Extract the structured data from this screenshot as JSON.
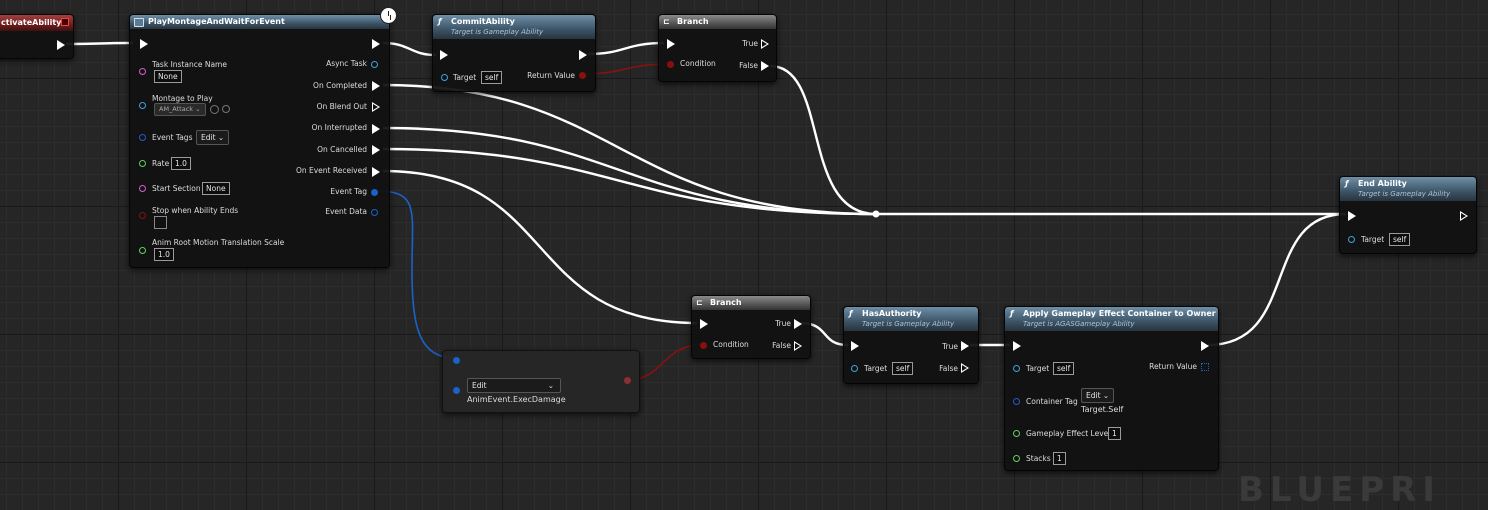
{
  "watermark": "BLUEPRI",
  "nodes": {
    "activate": {
      "title": "ctivateAbility"
    },
    "play_montage": {
      "title": "PlayMontageAndWaitForEvent",
      "task_instance_name": {
        "label": "Task Instance Name",
        "value": "None"
      },
      "montage_to_play": {
        "label": "Montage to Play",
        "value": "AM_Attack"
      },
      "event_tags": {
        "label": "Event Tags",
        "value": "Edit"
      },
      "rate": {
        "label": "Rate",
        "value": "1.0"
      },
      "start_section": {
        "label": "Start Section",
        "value": "None"
      },
      "stop_when_ability_ends": {
        "label": "Stop when Ability Ends"
      },
      "anim_root_motion": {
        "label": "Anim Root Motion Translation Scale",
        "value": "1.0"
      },
      "outputs": [
        "Async Task",
        "On Completed",
        "On Blend Out",
        "On Interrupted",
        "On Cancelled",
        "On Event Received",
        "Event Tag",
        "Event Data"
      ]
    },
    "commit_ability": {
      "title": "CommitAbility",
      "subtitle": "Target is Gameplay Ability",
      "target_label": "Target",
      "target_value": "self",
      "return_label": "Return Value"
    },
    "branch1": {
      "title": "Branch",
      "condition": "Condition",
      "true": "True",
      "false": "False"
    },
    "end_ability": {
      "title": "End Ability",
      "subtitle": "Target is Gameplay Ability",
      "target_label": "Target",
      "target_value": "self"
    },
    "make_tag": {
      "dropdown": "Edit",
      "tag_value": "AnimEvent.ExecDamage"
    },
    "branch2": {
      "title": "Branch",
      "condition": "Condition",
      "true": "True",
      "false": "False"
    },
    "has_authority": {
      "title": "HasAuthority",
      "subtitle": "Target is Gameplay Ability",
      "target_label": "Target",
      "target_value": "self",
      "true": "True",
      "false": "False"
    },
    "apply_ge": {
      "title": "Apply Gameplay Effect Container to Owner",
      "subtitle": "Target is AGASGameplay Ability",
      "target_label": "Target",
      "target_value": "self",
      "return_label": "Return Value",
      "container_tag_label": "Container Tag",
      "container_tag_dropdown": "Edit",
      "container_tag_value": "Target.Self",
      "level_label": "Gameplay Effect Level",
      "level_value": "1",
      "stacks_label": "Stacks",
      "stacks_value": "1"
    }
  },
  "colors": {
    "exec": "#ffffff",
    "bool": "#8a0f0f",
    "struct": "#1a62c9",
    "object": "#3ea3e0",
    "string": "#d75bd7",
    "float": "#63d05d"
  }
}
